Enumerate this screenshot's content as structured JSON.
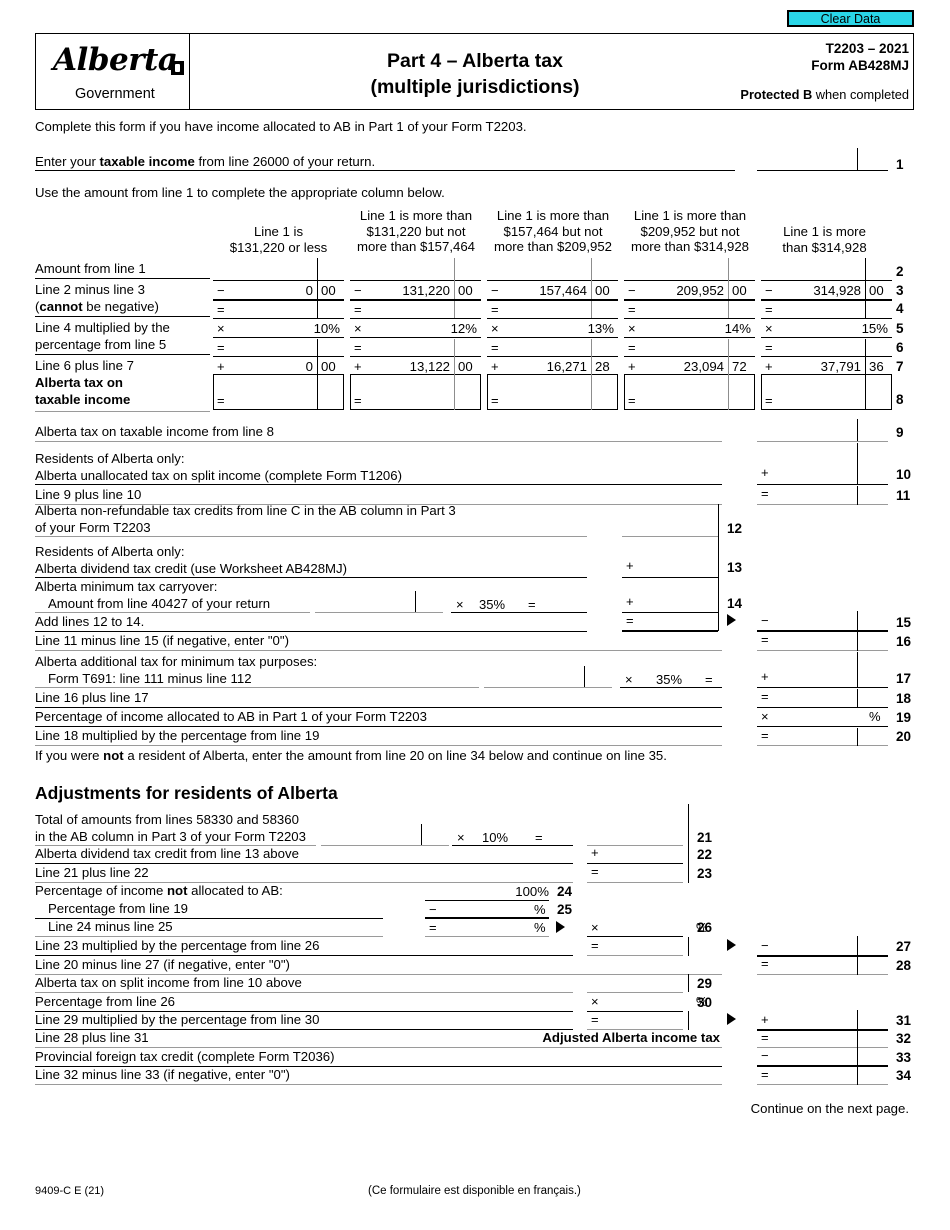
{
  "toolbar": {
    "clear_data_label": "Clear Data"
  },
  "header": {
    "logo_word": "Alberta",
    "logo_sub": "Government",
    "title_line1": "Part 4 – Alberta tax",
    "title_line2": "(multiple jurisdictions)",
    "form_year": "T2203 – 2021",
    "form_code": "Form AB428MJ",
    "protected_bold": "Protected B",
    "protected_rest": " when completed"
  },
  "intro": {
    "complete_note": "Complete this form if you have income allocated to AB in Part 1 of your Form T2203.",
    "line1_pre": "Enter your ",
    "line1_bold": "taxable income",
    "line1_post": " from line 26000 of your return.",
    "line1_num": "1",
    "use_amount_note": "Use the amount from line 1 to complete the appropriate column below."
  },
  "bracket_table": {
    "columns": [
      {
        "header": [
          "Line 1 is",
          "$131,220 or less"
        ],
        "line3": "0",
        "line3_cents": "00",
        "rate": "10%",
        "line7": "0",
        "line7_cents": "00"
      },
      {
        "header": [
          "Line 1 is more than",
          "$131,220 but not",
          "more than $157,464"
        ],
        "line3": "131,220",
        "line3_cents": "00",
        "rate": "12%",
        "line7": "13,122",
        "line7_cents": "00"
      },
      {
        "header": [
          "Line 1 is more than",
          "$157,464 but not",
          "more than $209,952"
        ],
        "line3": "157,464",
        "line3_cents": "00",
        "rate": "13%",
        "line7": "16,271",
        "line7_cents": "28"
      },
      {
        "header": [
          "Line 1 is more than",
          "$209,952 but not",
          "more than $314,928"
        ],
        "line3": "209,952",
        "line3_cents": "00",
        "rate": "14%",
        "line7": "23,094",
        "line7_cents": "72"
      },
      {
        "header": [
          "Line 1 is more",
          "than $314,928"
        ],
        "line3": "314,928",
        "line3_cents": "00",
        "rate": "15%",
        "line7": "37,791",
        "line7_cents": "36"
      }
    ],
    "row_labels": {
      "r2": "Amount from line 1",
      "r3a": "Line 2 minus line 3",
      "r3b_bold": "cannot",
      "r3b_pre": "(",
      "r3b_post": " be negative)",
      "r5a": "Line 4 multiplied by the",
      "r5b": "percentage from line 5",
      "r7": "Line 6 plus line 7",
      "r8a": "Alberta tax on",
      "r8b": "taxable income"
    },
    "row_numbers": [
      "2",
      "3",
      "4",
      "5",
      "6",
      "7",
      "8"
    ],
    "ops": {
      "minus": "−",
      "equals": "=",
      "times": "×",
      "plus": "+"
    }
  },
  "lines": {
    "l9": {
      "label": "Alberta tax on taxable income from line 8",
      "num": "9"
    },
    "l10": {
      "label_a": "Residents of Alberta only:",
      "label_b": "Alberta unallocated tax on split income (complete Form T1206)",
      "op": "+",
      "num": "10"
    },
    "l11": {
      "label": "Line 9 plus line 10",
      "op": "=",
      "num": "11"
    },
    "l12": {
      "label_a": "Alberta non-refundable tax credits from line C in the AB column in Part 3",
      "label_b": "of your Form T2203",
      "num": "12"
    },
    "l13": {
      "label_a": "Residents of Alberta only:",
      "label_b": "Alberta dividend tax credit (use Worksheet AB428MJ)",
      "op": "+",
      "num": "13"
    },
    "l14": {
      "label_a": "Alberta minimum tax carryover:",
      "label_b": "Amount from line 40427 of your return",
      "times": "×",
      "rate": "35%",
      "equals": "=",
      "op": "+",
      "num": "14"
    },
    "l15": {
      "label": "Add lines 12 to 14.",
      "op_inner": "=",
      "op": "−",
      "num": "15"
    },
    "l16": {
      "label": "Line 11 minus line 15 (if negative, enter \"0\")",
      "op": "=",
      "num": "16"
    },
    "l17": {
      "label_a": "Alberta additional tax for minimum tax purposes:",
      "label_b": "Form T691: line 111 minus line 112",
      "times": "×",
      "rate": "35%",
      "equals": "=",
      "op": "+",
      "num": "17"
    },
    "l18": {
      "label": "Line 16 plus line 17",
      "op": "=",
      "num": "18"
    },
    "l19": {
      "label": "Percentage of income allocated to AB in Part 1 of your Form T2203",
      "op": "×",
      "pct": "%",
      "num": "19"
    },
    "l20": {
      "label": "Line 18 multiplied by the percentage from line 19",
      "op": "=",
      "num": "20"
    },
    "not_resident_pre": "If you were ",
    "not_resident_bold": "not",
    "not_resident_post": " a resident of Alberta, enter the amount from line 20 on line 34 below and continue on line 35."
  },
  "adjustments": {
    "heading": "Adjustments for residents of Alberta",
    "l21": {
      "label_a": "Total of amounts from lines 58330 and 58360",
      "label_b": "in the AB column in Part 3 of your Form T2203",
      "times": "×",
      "rate": "10%",
      "equals": "=",
      "num": "21"
    },
    "l22": {
      "label": "Alberta dividend tax credit from line 13 above",
      "op": "+",
      "num": "22"
    },
    "l23": {
      "label": "Line 21 plus line 22",
      "op": "=",
      "num": "23"
    },
    "l24": {
      "label_pre": "Percentage of income ",
      "label_bold": "not",
      "label_post": " allocated to AB:",
      "value": "100%",
      "num": "24"
    },
    "l25": {
      "label": "Percentage from line 19",
      "op": "−",
      "pct": "%",
      "num": "25"
    },
    "l26": {
      "label": "Line 24 minus line 25",
      "op": "=",
      "pct": "%",
      "op_right": "×",
      "pct_right": "%",
      "num": "26"
    },
    "l27": {
      "label": "Line 23 multiplied by the percentage from line 26",
      "op_inner": "=",
      "op": "−",
      "num": "27"
    },
    "l28": {
      "label": "Line 20 minus line 27 (if negative, enter \"0\")",
      "op": "=",
      "num": "28"
    },
    "l29": {
      "label": "Alberta tax on split income from line 10 above",
      "num": "29"
    },
    "l30": {
      "label": "Percentage from line 26",
      "op": "×",
      "pct": "%",
      "num": "30"
    },
    "l31": {
      "label": "Line 29 multiplied by the percentage from line 30",
      "op_inner": "=",
      "op": "+",
      "num": "31"
    },
    "l32": {
      "label": "Line 28 plus line 31",
      "emph": "Adjusted Alberta income tax",
      "op": "=",
      "num": "32"
    },
    "l33": {
      "label": "Provincial foreign tax credit (complete Form T2036)",
      "op": "−",
      "num": "33"
    },
    "l34": {
      "label": "Line 32 minus line 33 (if negative, enter \"0\")",
      "op": "=",
      "num": "34"
    }
  },
  "footer": {
    "continue": "Continue on the next page.",
    "form_id": "9409-C E (21)",
    "french_note": "(Ce formulaire est disponible en français.)"
  },
  "colors": {
    "accent_cyan": "#2ad6e8",
    "rule_grey": "#9a9a9a"
  }
}
